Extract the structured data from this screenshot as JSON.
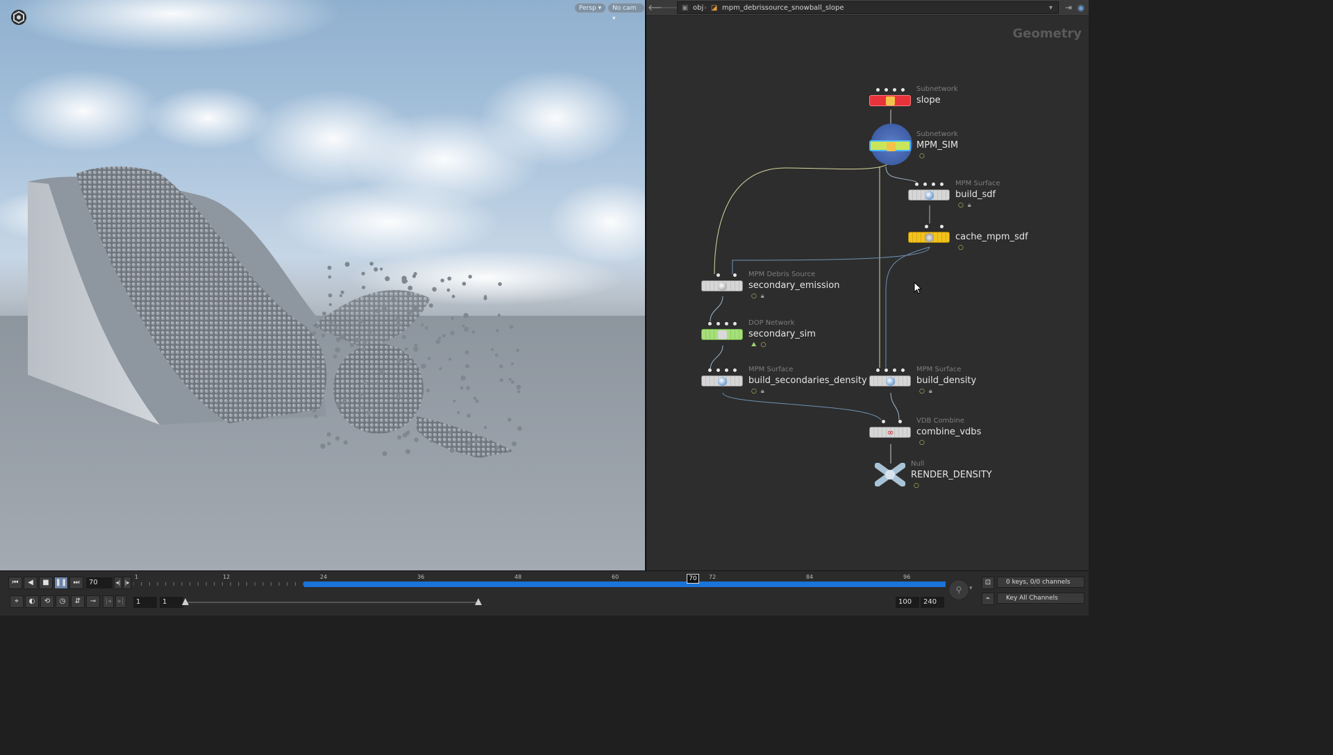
{
  "viewport": {
    "persp_label": "Persp ▾",
    "cam_label": "No cam ▾",
    "logo_icon": "houdini-logo-icon"
  },
  "network": {
    "path": {
      "root": "obj",
      "current": "mpm_debrissource_snowball_slope"
    },
    "context_label": "Geometry",
    "nodes": [
      {
        "type": "Subnetwork",
        "name": "slope"
      },
      {
        "type": "Subnetwork",
        "name": "MPM_SIM"
      },
      {
        "type": "MPM Surface",
        "name": "build_sdf"
      },
      {
        "type": "",
        "name": "cache_mpm_sdf"
      },
      {
        "type": "MPM Debris Source",
        "name": "secondary_emission"
      },
      {
        "type": "DOP Network",
        "name": "secondary_sim"
      },
      {
        "type": "MPM Surface",
        "name": "build_secondaries_density"
      },
      {
        "type": "MPM Surface",
        "name": "build_density"
      },
      {
        "type": "VDB Combine",
        "name": "combine_vdbs"
      },
      {
        "type": "Null",
        "name": "RENDER_DENSITY"
      }
    ]
  },
  "timeline": {
    "current_frame": "70",
    "marker_frame": "70",
    "ticks": [
      "1",
      "12",
      "24",
      "36",
      "48",
      "60",
      "72",
      "84",
      "96"
    ],
    "start_frame": "1",
    "start_frame2": "1",
    "end_frame": "100",
    "end_frame2": "240",
    "keys_label": "0 keys, 0/0 channels",
    "key_all_label": "Key All Channels"
  },
  "colors": {
    "range": "#1a73d9",
    "node_red": "#e8333b",
    "node_yellow_green": "#c9e65a",
    "node_yellow": "#f2c21e",
    "node_green": "#9bd66b"
  }
}
